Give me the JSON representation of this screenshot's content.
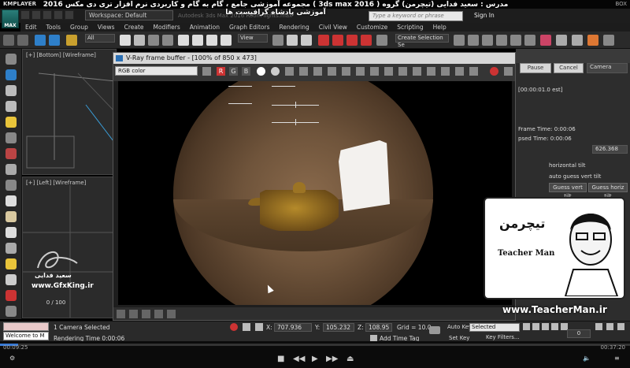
{
  "player": {
    "brand": "KMPLAYER",
    "overlay_title": "مجموعه آموزشی جامع ، گام به گام و کاربردی نرم افزار تری دی مکس 2016 ( 3ds max 2016 )  مدرس : سعید فدایی (تیچرمن) گروه آموزشی پادشاه گرافیست ها",
    "right_label": "BOX",
    "time_elapsed": "00:09:25",
    "time_total": "00:37:20",
    "progress": 0.029
  },
  "max": {
    "logo": "MAX",
    "workspace": "Workspace: Default",
    "title": "Autodesk 3ds Max 2016    Room lights.max",
    "search_placeholder": "Type a keyword or phrase",
    "signin": "Sign In",
    "menus": [
      "Edit",
      "Tools",
      "Group",
      "Views",
      "Create",
      "Modifiers",
      "Animation",
      "Graph Editors",
      "Rendering",
      "Civil View",
      "Customize",
      "Scripting",
      "Help"
    ],
    "selection_filter": "All",
    "ref_coord": "View",
    "selection_set": "Create Selection Se",
    "viewports": {
      "top_label": "[+] [Bottom] [Wireframe]",
      "left_label": "[+] [Left] [Wireframe]",
      "slider": "0 / 100"
    }
  },
  "rightpanel": {
    "pause": "Pause",
    "cancel": "Cancel",
    "camera": "Camera",
    "est": "[00:00:01.0 est]",
    "frame_time": "Frame Time: 0:00:06",
    "elapsed_time": "psed Time: 0:00:06",
    "val1": "626.368",
    "horizontal_tilt": "horizontal tilt",
    "auto_guess": "auto guess vert tilt",
    "guess_vert": "Guess vert tilt",
    "guess_horiz": "Guess horiz tilt"
  },
  "vfb": {
    "title": "V-Ray frame buffer - [100% of 850 x 473]",
    "channel": "RGB color",
    "r": "R",
    "g": "G",
    "b": "B"
  },
  "status": {
    "maxscript_text": "Welcome to M",
    "selected": "1 Camera Selected",
    "render_time": "Rendering Time  0:00:06",
    "x_label": "X:",
    "x_value": "707.936",
    "y_label": "Y:",
    "y_value": "105.232",
    "z_label": "Z:",
    "z_value": "108.95",
    "grid": "Grid = 10.0",
    "add_time_tag": "Add Time Tag",
    "auto_key": "Auto Key",
    "set_key": "Set Key",
    "selected_dd": "Selected",
    "key_filters": "Key Filters...",
    "frame": "0"
  },
  "watermarks": {
    "gfx_name": "سعید فدایی",
    "gfx_site": "www.GfxKing.ir",
    "teacher_fa": "تیچرمن",
    "teacher_en": "Teacher Man",
    "teacher_url": "www.TeacherMan.ir"
  },
  "colors": {
    "accent": "#3a7bd5",
    "max_logo": "#2a7f7a"
  }
}
